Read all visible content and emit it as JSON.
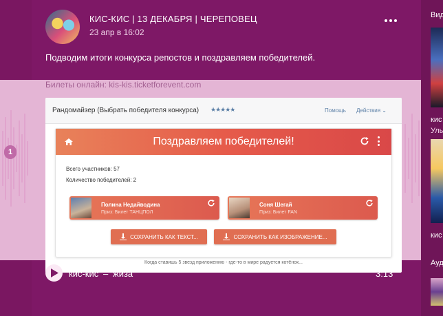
{
  "post": {
    "author": "КИС-КИС | 13 ДЕКАБРЯ | ЧЕРЕПОВЕЦ",
    "date": "23 апр в 16:02",
    "text": "Подводим итоги конкурса репостов и поздравляем победителей.",
    "link_text": "Билеты онлайн: kis-kis.ticketforevent.com",
    "badge": "1"
  },
  "screenshot": {
    "app_title": "Рандомайзер (Выбрать победителя конкурса)",
    "stars": "★★★★★",
    "help": "Помощь",
    "actions": "Действия ⌄",
    "header_title": "Поздравляем победителей!",
    "participants": "Всего участников: 57",
    "winners_count": "Количество победителей: 2",
    "winners": [
      {
        "name": "Полина Недайводина",
        "prize": "Приз: Билет ТАНЦПОЛ"
      },
      {
        "name": "Соня Шегай",
        "prize": "Приз: Билет FAN"
      }
    ],
    "save_text": "СОХРАНИТЬ КАК ТЕКСТ...",
    "save_image": "СОХРАНИТЬ КАК ИЗОБРАЖЕНИЕ...",
    "footer": "Когда ставишь 5 звезд приложению - где-то в мире радуется котёнок..."
  },
  "audio": {
    "artist": "кис-кис",
    "separator": "–",
    "title": "жиза",
    "duration": "3:13"
  },
  "sidebar": {
    "heading_1": "Вид",
    "caption_1": "кис",
    "caption_2": "Улы",
    "caption_3": "кис",
    "heading_2": "Ауд"
  },
  "colors": {
    "page_bg": "#7a1761",
    "band": "#e4b5d5",
    "accent_orange": "#e65b4a"
  }
}
